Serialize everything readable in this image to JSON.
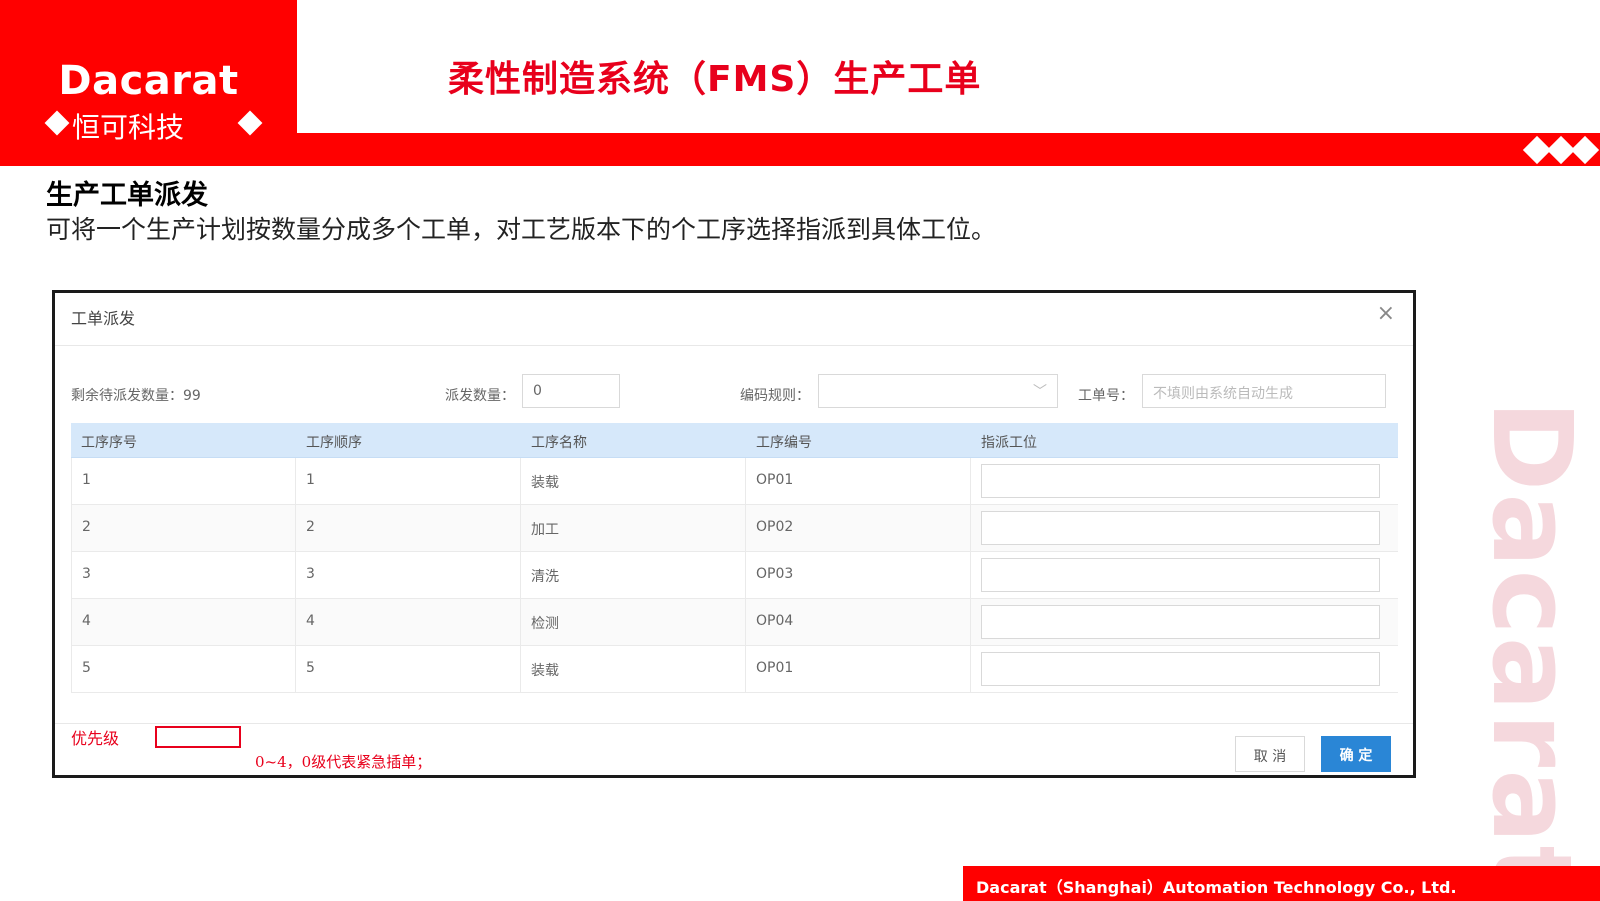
{
  "brand": {
    "logo": "Dacarat",
    "logo_sub": "恒可科技",
    "watermark": "Dacarat",
    "footer": "Dacarat（Shanghai）Automation Technology Co., Ltd.",
    "accent": "#ff0000"
  },
  "slide": {
    "title": "柔性制造系统（FMS）生产工单",
    "section_title": "生产工单派发",
    "section_desc": "可将一个生产计划按数量分成多个工单，对工艺版本下的个工序选择指派到具体工位。"
  },
  "dialog": {
    "title": "工单派发",
    "close": "×",
    "remaining_label": "剩余待派发数量：99",
    "dispatch_qty_label": "派发数量：",
    "dispatch_qty_value": "0",
    "code_rule_label": "编码规则：",
    "code_rule_value": "",
    "order_no_label": "工单号：",
    "order_no_placeholder": "不填则由系统自动生成",
    "table": {
      "columns": [
        "工序序号",
        "工序顺序",
        "工序名称",
        "工序编号",
        "指派工位"
      ],
      "rows": [
        [
          "1",
          "1",
          "装载",
          "OP01",
          ""
        ],
        [
          "2",
          "2",
          "加工",
          "OP02",
          ""
        ],
        [
          "3",
          "3",
          "清洗",
          "OP03",
          ""
        ],
        [
          "4",
          "4",
          "检测",
          "OP04",
          ""
        ],
        [
          "5",
          "5",
          "装载",
          "OP01",
          ""
        ]
      ]
    },
    "priority_label": "优先级",
    "priority_hint": "0~4，0级代表紧急插单；",
    "cancel": "取 消",
    "confirm": "确 定"
  }
}
